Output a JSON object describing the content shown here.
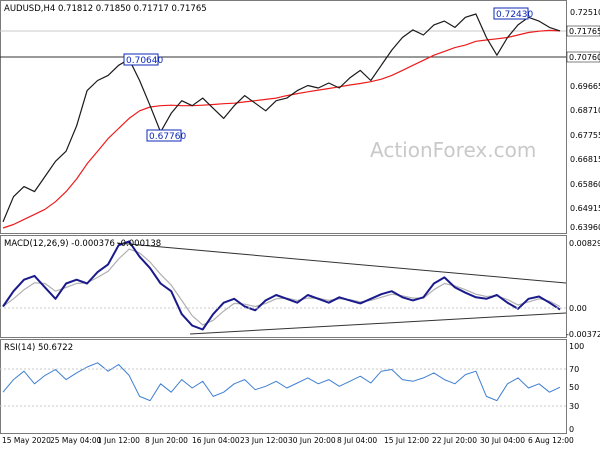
{
  "colors": {
    "price": "#1a1a1a",
    "ma": "#ee1c1c",
    "macd": "#1a1a8c",
    "signal": "#b0b0b0",
    "rsi": "#3f80d2",
    "grid": "#c8c8c8",
    "watermark": "#c9c9c9",
    "label_box": "#0c2ab8"
  },
  "price_panel": {
    "header": "AUDUSD,H4  0.71812 0.71850 0.71717 0.71765",
    "y_ticks": [
      "0.72510",
      "0.71765",
      "0.70760",
      "0.69665",
      "0.68710",
      "0.67755",
      "0.66815",
      "0.65860",
      "0.64915",
      "0.63960"
    ],
    "annotations": [
      {
        "label": "0.70640"
      },
      {
        "label": "0.67760"
      },
      {
        "label": "0.72430"
      }
    ],
    "watermark": "ActionForex.com"
  },
  "macd_panel": {
    "header": "MACD(12,26,9) -0.000376 -0.000138",
    "y_ticks": [
      "0.008296",
      "0.00",
      "-0.003725"
    ]
  },
  "rsi_panel": {
    "header": "RSI(14) 50.6722",
    "y_ticks": [
      "100",
      "70",
      "50",
      "30",
      "0"
    ]
  },
  "x_ticks": [
    "15 May 2020",
    "25 May 04:00",
    "1 Jun 12:00",
    "8 Jun 20:00",
    "16 Jun 04:00",
    "23 Jun 12:00",
    "30 Jun 20:00",
    "8 Jul 04:00",
    "15 Jul 12:00",
    "22 Jul 20:00",
    "30 Jul 04:00",
    "6 Aug 12:00"
  ],
  "chart_data": [
    {
      "type": "line",
      "title": "AUDUSD,H4",
      "x": [
        "15 May 2020",
        "25 May 04:00",
        "1 Jun 12:00",
        "8 Jun 20:00",
        "16 Jun 04:00",
        "23 Jun 12:00",
        "30 Jun 20:00",
        "8 Jul 04:00",
        "15 Jul 12:00",
        "22 Jul 20:00",
        "30 Jul 04:00",
        "6 Aug 12:00"
      ],
      "ylim": [
        0.6396,
        0.7251
      ],
      "series": [
        {
          "name": "AUDUSD",
          "values": [
            0.642,
            0.652,
            0.656,
            0.654,
            0.66,
            0.666,
            0.67,
            0.68,
            0.694,
            0.698,
            0.7,
            0.704,
            0.7064,
            0.698,
            0.688,
            0.6776,
            0.685,
            0.69,
            0.688,
            0.691,
            0.687,
            0.683,
            0.688,
            0.692,
            0.689,
            0.686,
            0.69,
            0.691,
            0.694,
            0.696,
            0.695,
            0.697,
            0.695,
            0.699,
            0.702,
            0.698,
            0.704,
            0.71,
            0.715,
            0.718,
            0.716,
            0.72,
            0.7215,
            0.719,
            0.723,
            0.7243,
            0.715,
            0.708,
            0.715,
            0.72,
            0.723,
            0.7215,
            0.719,
            0.7176
          ]
        },
        {
          "name": "MA",
          "values": [
            0.6396,
            0.641,
            0.643,
            0.645,
            0.647,
            0.65,
            0.654,
            0.659,
            0.665,
            0.67,
            0.675,
            0.679,
            0.683,
            0.686,
            0.6875,
            0.688,
            0.6882,
            0.688,
            0.688,
            0.6882,
            0.6885,
            0.6888,
            0.689,
            0.6895,
            0.69,
            0.6905,
            0.691,
            0.692,
            0.6928,
            0.6935,
            0.6942,
            0.6948,
            0.6955,
            0.6962,
            0.6968,
            0.6975,
            0.6985,
            0.7,
            0.702,
            0.704,
            0.706,
            0.708,
            0.7095,
            0.711,
            0.712,
            0.7135,
            0.714,
            0.7145,
            0.715,
            0.716,
            0.717,
            0.7175,
            0.7178,
            0.7176
          ]
        }
      ]
    },
    {
      "type": "line",
      "title": "MACD(12,26,9)",
      "ylim": [
        -0.003725,
        0.008296
      ],
      "series": [
        {
          "name": "MACD",
          "values": [
            0.0,
            0.002,
            0.0035,
            0.004,
            0.0025,
            0.001,
            0.003,
            0.0035,
            0.003,
            0.0045,
            0.0055,
            0.008,
            0.0085,
            0.0065,
            0.005,
            0.003,
            0.002,
            -0.001,
            -0.0025,
            -0.003,
            -0.001,
            0.0005,
            0.001,
            0.0,
            -0.0005,
            0.0008,
            0.0015,
            0.001,
            0.0005,
            0.0015,
            0.001,
            0.0005,
            0.0012,
            0.0008,
            0.0004,
            0.001,
            0.0016,
            0.002,
            0.0012,
            0.0008,
            0.0012,
            0.003,
            0.0038,
            0.0025,
            0.0018,
            0.0012,
            0.001,
            0.0015,
            0.0005,
            -0.0003,
            0.001,
            0.0013,
            0.0005,
            -0.0004
          ]
        },
        {
          "name": "Signal",
          "values": [
            0.0,
            0.001,
            0.0022,
            0.0031,
            0.003,
            0.002,
            0.0025,
            0.003,
            0.0031,
            0.0038,
            0.0046,
            0.0062,
            0.0075,
            0.007,
            0.0058,
            0.0042,
            0.0028,
            0.0008,
            -0.0012,
            -0.0024,
            -0.0018,
            -0.0006,
            0.0004,
            0.0003,
            0.0,
            0.0004,
            0.001,
            0.0011,
            0.0008,
            0.0011,
            0.0011,
            0.0008,
            0.001,
            0.0009,
            0.0006,
            0.0008,
            0.0012,
            0.0016,
            0.0014,
            0.0011,
            0.0011,
            0.0022,
            0.003,
            0.0027,
            0.0022,
            0.0016,
            0.0013,
            0.0014,
            0.0009,
            0.0002,
            0.0006,
            0.001,
            0.0007,
            0.0
          ]
        }
      ]
    },
    {
      "type": "line",
      "title": "RSI(14)",
      "ylim": [
        0,
        100
      ],
      "series": [
        {
          "name": "RSI(14)",
          "values": [
            45,
            60,
            70,
            55,
            65,
            72,
            60,
            68,
            75,
            80,
            70,
            78,
            65,
            40,
            35,
            55,
            45,
            60,
            50,
            58,
            40,
            45,
            55,
            60,
            48,
            52,
            58,
            50,
            56,
            62,
            55,
            60,
            52,
            58,
            64,
            56,
            70,
            72,
            60,
            58,
            62,
            68,
            60,
            55,
            66,
            70,
            40,
            35,
            55,
            62,
            50,
            55,
            45,
            51
          ]
        }
      ]
    }
  ]
}
